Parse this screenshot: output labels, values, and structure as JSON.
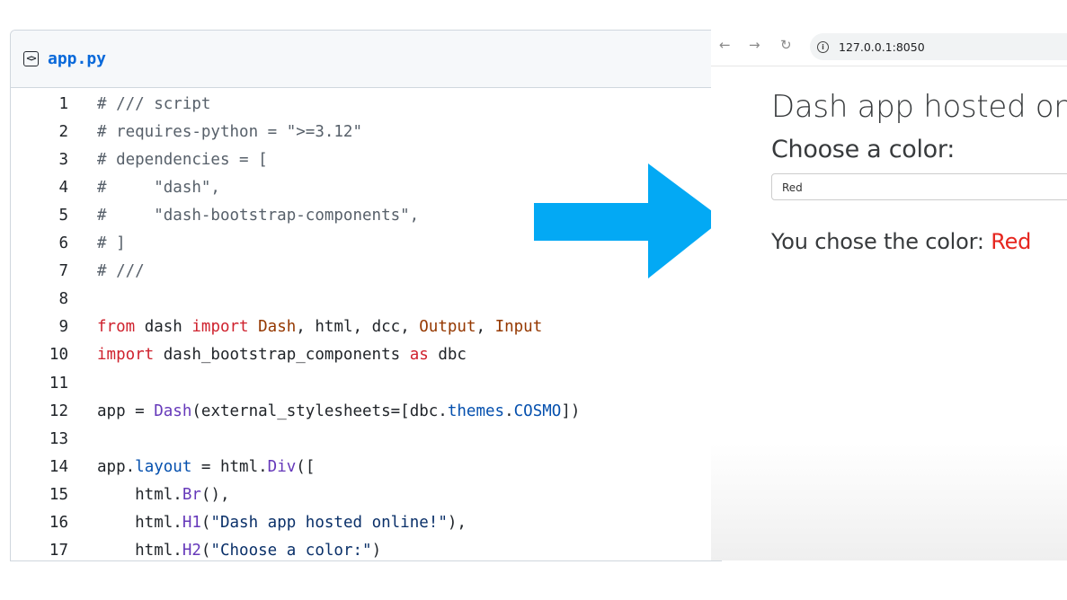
{
  "editor": {
    "icon": "code-file-icon",
    "filename": "app.py",
    "lines": [
      {
        "n": "1",
        "tokens": [
          {
            "t": "# /// script",
            "c": "comment"
          }
        ]
      },
      {
        "n": "2",
        "tokens": [
          {
            "t": "# requires-python = \">=3.12\"",
            "c": "comment"
          }
        ]
      },
      {
        "n": "3",
        "tokens": [
          {
            "t": "# dependencies = [",
            "c": "comment"
          }
        ]
      },
      {
        "n": "4",
        "tokens": [
          {
            "t": "#     \"dash\",",
            "c": "comment"
          }
        ]
      },
      {
        "n": "5",
        "tokens": [
          {
            "t": "#     \"dash-bootstrap-components\",",
            "c": "comment"
          }
        ]
      },
      {
        "n": "6",
        "tokens": [
          {
            "t": "# ]",
            "c": "comment"
          }
        ]
      },
      {
        "n": "7",
        "tokens": [
          {
            "t": "# ///",
            "c": "comment"
          }
        ]
      },
      {
        "n": "8",
        "tokens": []
      },
      {
        "n": "9",
        "tokens": [
          {
            "t": "from",
            "c": "kw"
          },
          {
            "t": " dash ",
            "c": "plain"
          },
          {
            "t": "import",
            "c": "kw"
          },
          {
            "t": " ",
            "c": "plain"
          },
          {
            "t": "Dash",
            "c": "cls"
          },
          {
            "t": ", html, dcc, ",
            "c": "plain"
          },
          {
            "t": "Output",
            "c": "cls"
          },
          {
            "t": ", ",
            "c": "plain"
          },
          {
            "t": "Input",
            "c": "cls"
          }
        ]
      },
      {
        "n": "10",
        "tokens": [
          {
            "t": "import",
            "c": "kw"
          },
          {
            "t": " dash_bootstrap_components ",
            "c": "plain"
          },
          {
            "t": "as",
            "c": "kw"
          },
          {
            "t": " dbc",
            "c": "plain"
          }
        ]
      },
      {
        "n": "11",
        "tokens": []
      },
      {
        "n": "12",
        "tokens": [
          {
            "t": "app = ",
            "c": "plain"
          },
          {
            "t": "Dash",
            "c": "fn"
          },
          {
            "t": "(external_stylesheets=[dbc.",
            "c": "plain"
          },
          {
            "t": "themes",
            "c": "attr"
          },
          {
            "t": ".",
            "c": "plain"
          },
          {
            "t": "COSMO",
            "c": "attr"
          },
          {
            "t": "])",
            "c": "plain"
          }
        ]
      },
      {
        "n": "13",
        "tokens": []
      },
      {
        "n": "14",
        "tokens": [
          {
            "t": "app.",
            "c": "plain"
          },
          {
            "t": "layout",
            "c": "attr"
          },
          {
            "t": " = html.",
            "c": "plain"
          },
          {
            "t": "Div",
            "c": "fn"
          },
          {
            "t": "([",
            "c": "plain"
          }
        ]
      },
      {
        "n": "15",
        "tokens": [
          {
            "t": "    html.",
            "c": "plain"
          },
          {
            "t": "Br",
            "c": "fn"
          },
          {
            "t": "(),",
            "c": "plain"
          }
        ]
      },
      {
        "n": "16",
        "tokens": [
          {
            "t": "    html.",
            "c": "plain"
          },
          {
            "t": "H1",
            "c": "fn"
          },
          {
            "t": "(",
            "c": "plain"
          },
          {
            "t": "\"Dash app hosted online!\"",
            "c": "str"
          },
          {
            "t": "),",
            "c": "plain"
          }
        ]
      },
      {
        "n": "17",
        "tokens": [
          {
            "t": "    html.",
            "c": "plain"
          },
          {
            "t": "H2",
            "c": "fn"
          },
          {
            "t": "(",
            "c": "plain"
          },
          {
            "t": "\"Choose a color:\"",
            "c": "str"
          },
          {
            "t": ")",
            "c": "plain"
          }
        ]
      }
    ]
  },
  "browser": {
    "back_icon": "←",
    "forward_icon": "→",
    "reload_icon": "↻",
    "url": "127.0.0.1:8050",
    "page": {
      "title": "Dash app hosted online!",
      "subtitle": "Choose a color:",
      "dropdown_value": "Red",
      "result_prefix": "You chose the color: ",
      "result_value": "Red",
      "result_color": "#e6261f"
    }
  },
  "arrow": {
    "icon": "right-arrow-icon",
    "color": "#03a9f4"
  }
}
